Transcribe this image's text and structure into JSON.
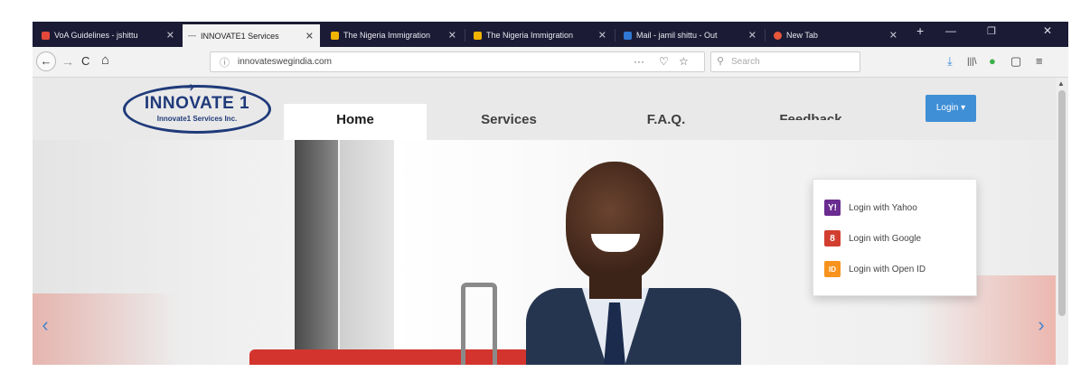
{
  "browser": {
    "tabs": [
      {
        "title": "VoA Guidelines - jshittu",
        "icon_color": "#e3493b",
        "active": false
      },
      {
        "title": "INNOVATE1 Services",
        "icon_color": "#8a8a8a",
        "active": true
      },
      {
        "title": "The Nigeria Immigration",
        "icon_color": "#f0b400",
        "active": false
      },
      {
        "title": "The Nigeria Immigration",
        "icon_color": "#f0b400",
        "active": false
      },
      {
        "title": "Mail - jamil shittu - Out",
        "icon_color": "#2f78d4",
        "active": false
      },
      {
        "title": "New Tab",
        "icon_color": "#e8573a",
        "active": false
      }
    ],
    "new_tab_symbol": "+",
    "url": "innovateswegindia.com",
    "search_placeholder": "Search",
    "nav_icons": {
      "back": "←",
      "forward": "→",
      "reload": "C",
      "home": "⌂"
    },
    "url_actions": {
      "more": "···",
      "pocket": "♡",
      "bookmark": "☆"
    },
    "toolbar_icons": {
      "download": "⤓",
      "library": "|||\\",
      "extension": "●",
      "sidebar": "▢",
      "menu": "≡"
    },
    "window_controls": {
      "list": "⌄",
      "minimize": "—",
      "restore": "❐",
      "close": "✕"
    }
  },
  "site": {
    "logo": {
      "title": "INNOVATE 1",
      "subtitle": "Innovate1 Services Inc."
    },
    "nav": [
      {
        "label": "Home",
        "active": true
      },
      {
        "label": "Services",
        "active": false
      },
      {
        "label": "F.A.Q.",
        "active": false
      },
      {
        "label": "Feedback",
        "active": false
      }
    ],
    "login_button": "Login ▾",
    "login_options": [
      {
        "label": "Login with Yahoo",
        "icon_letter": "Y!",
        "icon_color": "#6a2c91"
      },
      {
        "label": "Login with Google",
        "icon_letter": "8",
        "icon_color": "#d23f31"
      },
      {
        "label": "Login with Open ID",
        "icon_letter": "ID",
        "icon_color": "#f7931e"
      }
    ],
    "carousel": {
      "prev": "‹",
      "next": "›"
    }
  },
  "colors": {
    "tabstrip": "#1c1b35",
    "brand": "#1f3a7a",
    "login_blue": "#3f8fd6"
  }
}
